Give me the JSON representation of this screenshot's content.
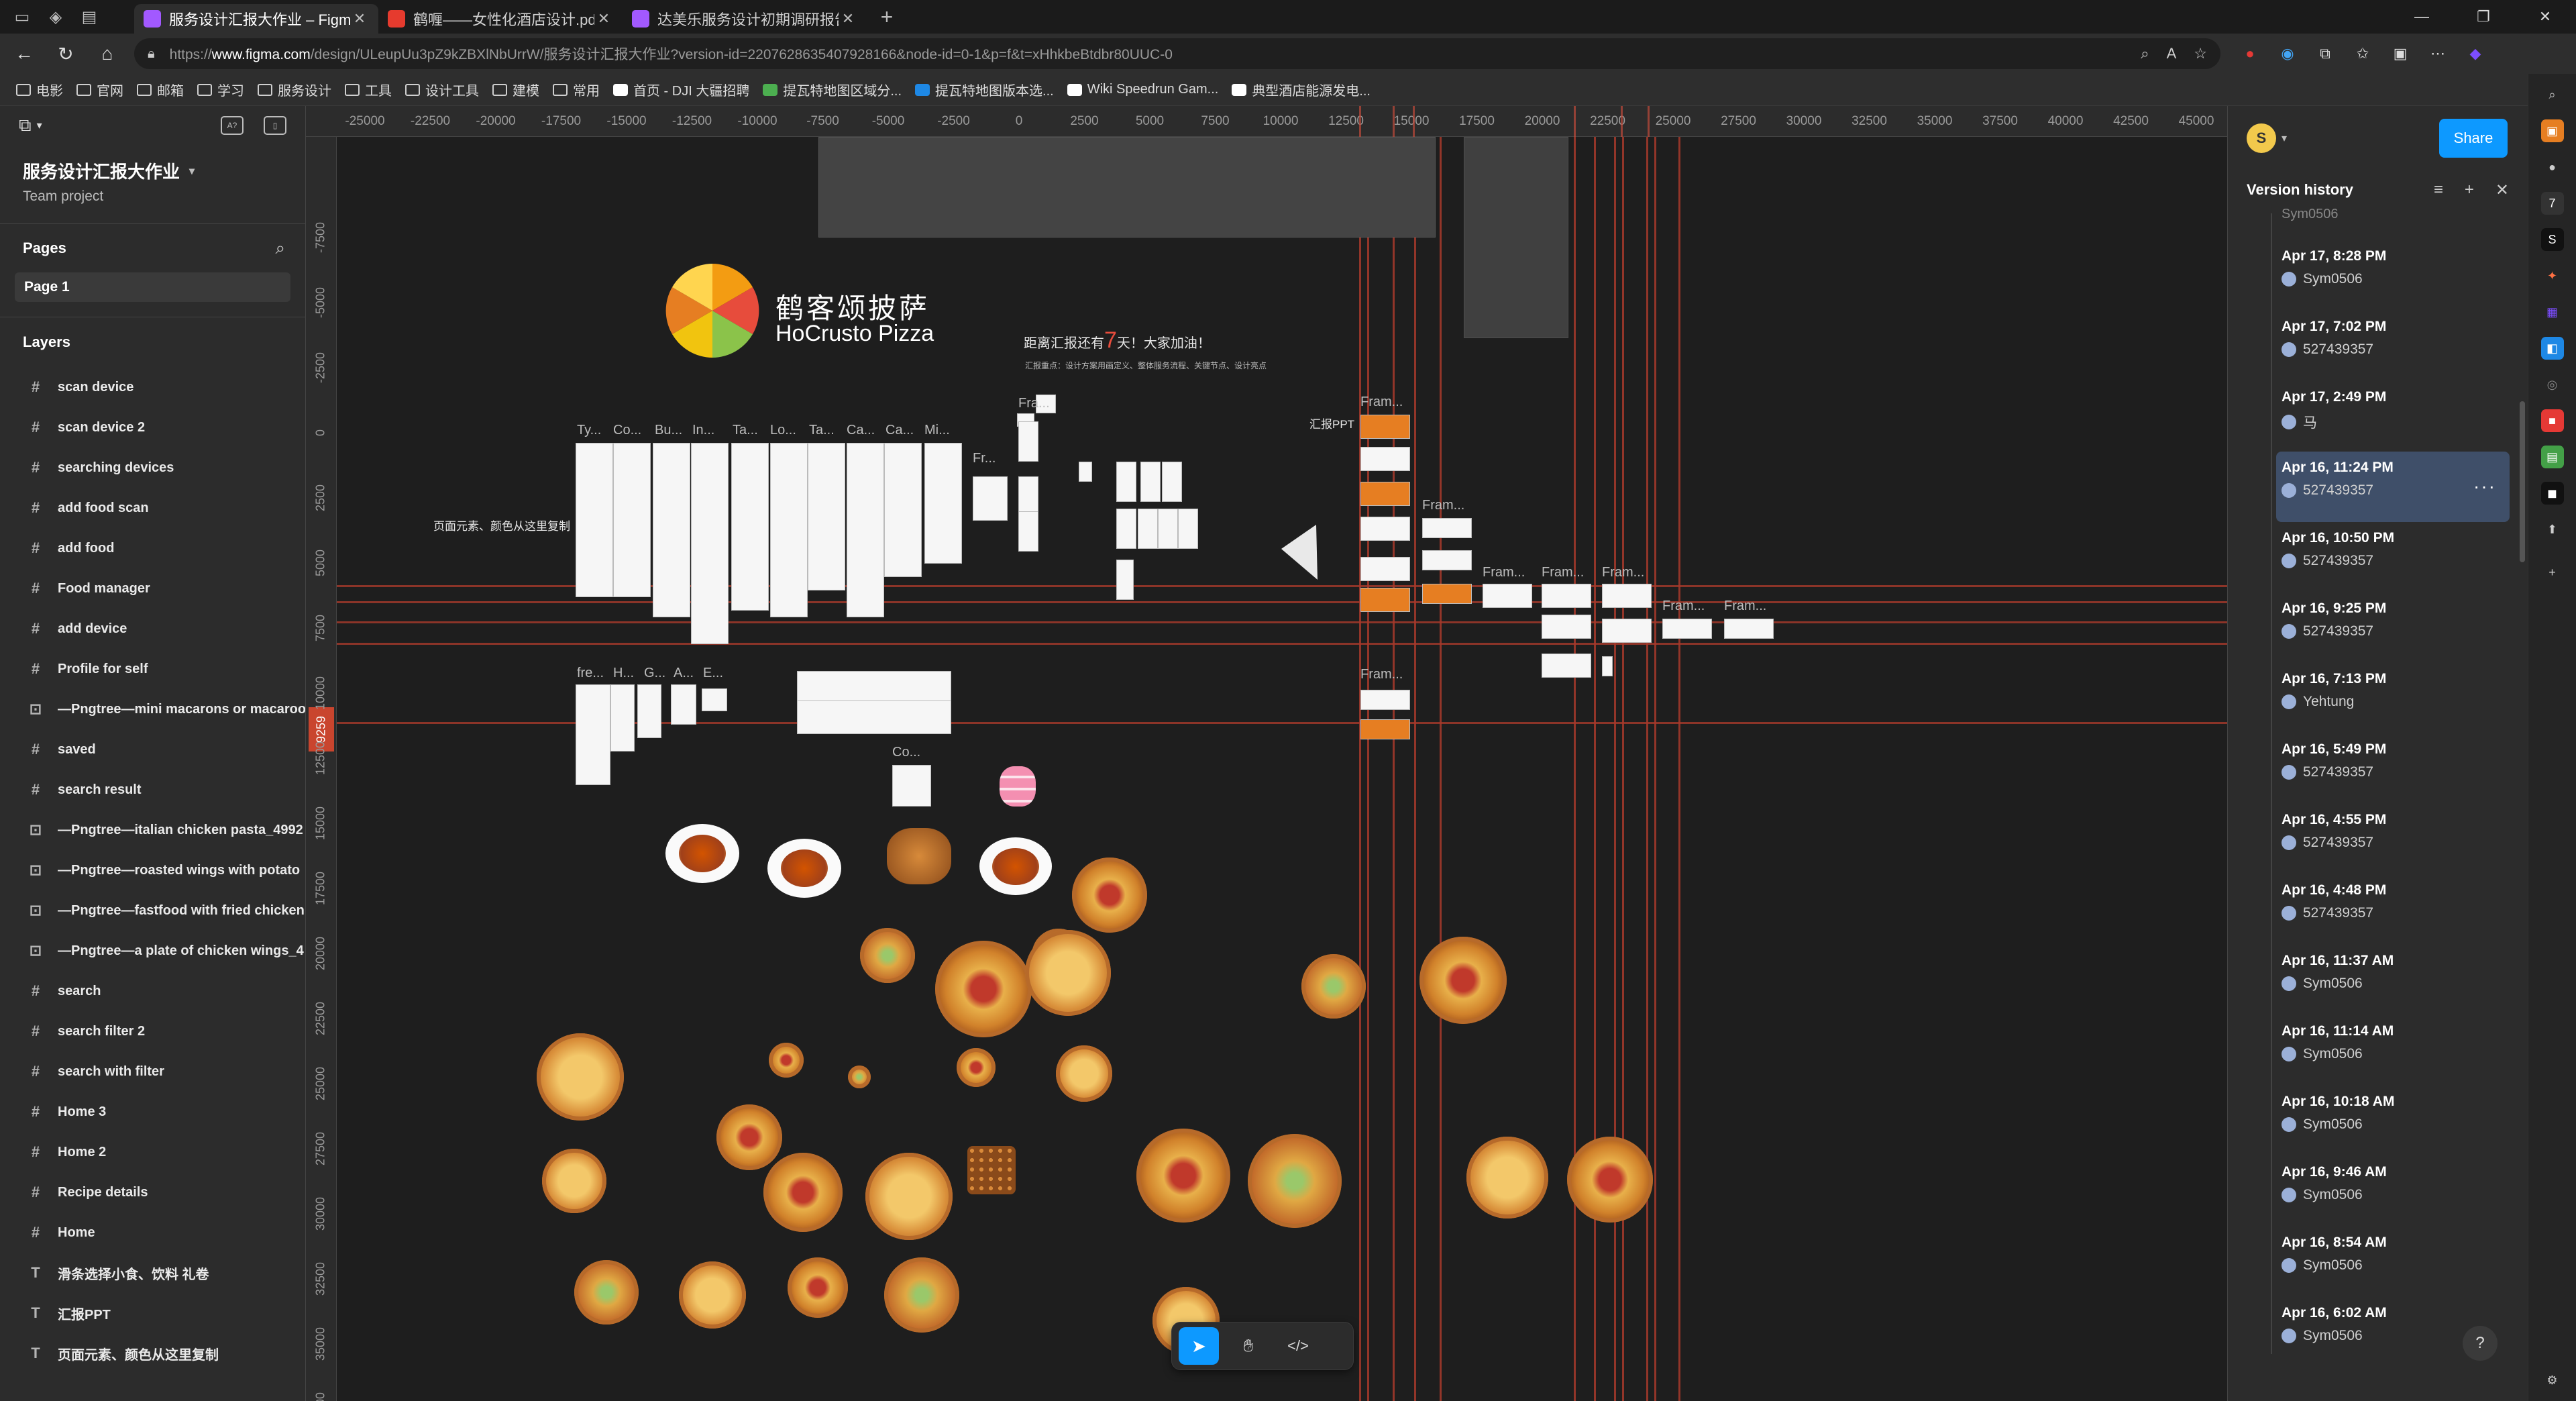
{
  "browser": {
    "tabs": [
      {
        "title": "服务设计汇报大作业 – Figma",
        "color": "#a259ff",
        "active": true
      },
      {
        "title": "鹤喱——女性化酒店设计.pdf",
        "color": "#e63b2e",
        "active": false
      },
      {
        "title": "达美乐服务设计初期调研报告 – Fi",
        "color": "#a259ff",
        "active": false
      }
    ],
    "url_prefix": "https://",
    "url_host": "www.figma.com",
    "url_rest": "/design/ULeupUu3pZ9kZBXlNbUrrW/服务设计汇报大作业?version-id=2207628635407928166&node-id=0-1&p=f&t=xHhkbeBtdbr80UUC-0",
    "bookmarks": [
      "电影",
      "官网",
      "邮箱",
      "学习",
      "服务设计",
      "工具",
      "设计工具",
      "建模",
      "常用",
      "首页 - DJI 大疆招聘",
      "提瓦特地图区域分...",
      "提瓦特地图版本选...",
      "Wiki Speedrun Gam...",
      "典型酒店能源发电..."
    ]
  },
  "figma": {
    "project_name": "服务设计汇报大作业",
    "project_sub": "Team project",
    "pages_label": "Pages",
    "current_page": "Page 1",
    "layers_label": "Layers",
    "layers": [
      {
        "icon": "frame",
        "name": "scan device"
      },
      {
        "icon": "frame",
        "name": "scan device 2"
      },
      {
        "icon": "frame",
        "name": "searching devices"
      },
      {
        "icon": "frame",
        "name": "add food scan"
      },
      {
        "icon": "frame",
        "name": "add food"
      },
      {
        "icon": "frame",
        "name": "Food manager"
      },
      {
        "icon": "frame",
        "name": "add device"
      },
      {
        "icon": "frame",
        "name": "Profile for self"
      },
      {
        "icon": "image",
        "name": "—Pngtree—mini macarons or macaroo"
      },
      {
        "icon": "frame",
        "name": "saved"
      },
      {
        "icon": "frame",
        "name": "search result"
      },
      {
        "icon": "image",
        "name": "—Pngtree—italian chicken pasta_4992"
      },
      {
        "icon": "image",
        "name": "—Pngtree—roasted wings with potato"
      },
      {
        "icon": "image",
        "name": "—Pngtree—fastfood with fried chicken"
      },
      {
        "icon": "image",
        "name": "—Pngtree—a plate of chicken wings_4"
      },
      {
        "icon": "frame",
        "name": "search"
      },
      {
        "icon": "frame",
        "name": "search filter 2"
      },
      {
        "icon": "frame",
        "name": "search with filter"
      },
      {
        "icon": "frame",
        "name": "Home 3"
      },
      {
        "icon": "frame",
        "name": "Home 2"
      },
      {
        "icon": "frame",
        "name": "Recipe details"
      },
      {
        "icon": "frame",
        "name": "Home"
      },
      {
        "icon": "text",
        "name": "滑条选择小食、饮料 礼卷"
      },
      {
        "icon": "text",
        "name": "汇报PPT"
      },
      {
        "icon": "text",
        "name": "页面元素、颜色从这里复制"
      }
    ],
    "ruler_x": [
      "-25000",
      "-22500",
      "-20000",
      "-17500",
      "-15000",
      "-12500",
      "-10000",
      "-7500",
      "-5000",
      "-2500",
      "0",
      "2500",
      "5000",
      "7500",
      "10000",
      "12500",
      "15000",
      "17500",
      "20000",
      "22500",
      "25000",
      "27500",
      "30000",
      "32500",
      "35000",
      "37500",
      "40000",
      "42500",
      "45000"
    ],
    "ruler_y": [
      "-7500",
      "-5000",
      "-2500",
      "0",
      "2500",
      "5000",
      "7500",
      "10000",
      "12500",
      "15000",
      "17500",
      "20000",
      "22500",
      "25000",
      "27500",
      "30000",
      "32500",
      "35000",
      "37500"
    ],
    "ruler_marker": "9259",
    "canvas_text": {
      "brand_cn": "鹤客颂披萨",
      "brand_en": "HoCrusto Pizza",
      "countdown_pre": "距离汇报还有",
      "countdown_num": "7",
      "countdown_post": "天！大家加油！",
      "countdown_sub": "汇报重点：设计方案用画定义、整体服务流程、关键节点、设计亮点",
      "copy_note": "页面元素、颜色从这里复制",
      "ppt_label": "汇报PPT",
      "frame_labels": [
        "Ty...",
        "Co...",
        "Bu...",
        "In...",
        "Ta...",
        "Lo...",
        "Ta...",
        "Ca...",
        "Ca...",
        "Mi...",
        "Fr...",
        "Fra...",
        "Fram...",
        "Fram...",
        "Fram...",
        "Fram...",
        "Fram...",
        "Fram...",
        "Fram...",
        "Fram...",
        "fre...",
        "H...",
        "G...",
        "A...",
        "E...",
        "Co..."
      ]
    },
    "tools": {
      "move": "move-tool",
      "hand": "hand-tool",
      "dev": "dev-mode"
    },
    "share_label": "Share",
    "avatar_letter": "S",
    "version_history": {
      "title": "Version history",
      "versions": [
        {
          "date": "Apr 17, 8:28 PM",
          "user": "Sym0506"
        },
        {
          "date": "Apr 17, 7:02 PM",
          "user": "527439357"
        },
        {
          "date": "Apr 17, 2:49 PM",
          "user": "马"
        },
        {
          "date": "Apr 16, 11:24 PM",
          "user": "527439357",
          "selected": true
        },
        {
          "date": "Apr 16, 10:50 PM",
          "user": "527439357"
        },
        {
          "date": "Apr 16, 9:25 PM",
          "user": "527439357"
        },
        {
          "date": "Apr 16, 7:13 PM",
          "user": "Yehtung"
        },
        {
          "date": "Apr 16, 5:49 PM",
          "user": "527439357"
        },
        {
          "date": "Apr 16, 4:55 PM",
          "user": "527439357"
        },
        {
          "date": "Apr 16, 4:48 PM",
          "user": "527439357"
        },
        {
          "date": "Apr 16, 11:37 AM",
          "user": "Sym0506"
        },
        {
          "date": "Apr 16, 11:14 AM",
          "user": "Sym0506"
        },
        {
          "date": "Apr 16, 10:18 AM",
          "user": "Sym0506"
        },
        {
          "date": "Apr 16, 9:46 AM",
          "user": "Sym0506"
        },
        {
          "date": "Apr 16, 8:54 AM",
          "user": "Sym0506"
        },
        {
          "date": "Apr 16, 6:02 AM",
          "user": "Sym0506"
        }
      ],
      "top_partial_user": "Sym0506"
    }
  },
  "colors": {
    "accent": "#0d99ff",
    "guide": "#a73a2b",
    "brand_orange": "#e67e22"
  }
}
